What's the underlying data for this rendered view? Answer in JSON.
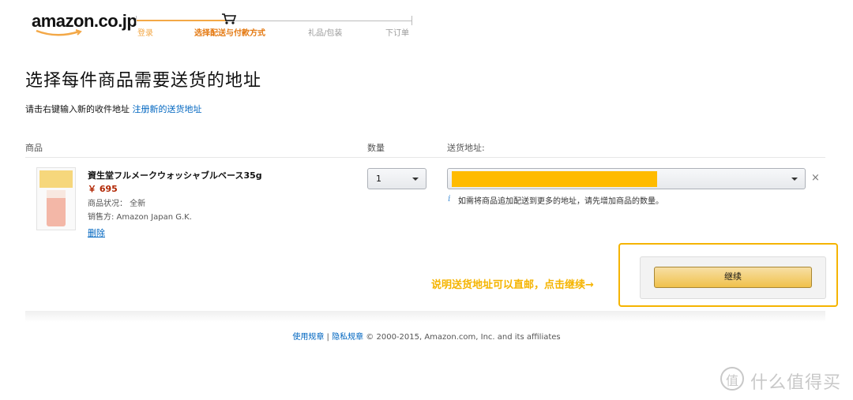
{
  "brand": {
    "logo_text": "amazon.co.jp",
    "accent": "#f3a847"
  },
  "progress": {
    "steps": [
      {
        "label": "登录",
        "state": "done"
      },
      {
        "label": "选择配送与付款方式",
        "state": "current"
      },
      {
        "label": "礼品/包装",
        "state": "pending"
      },
      {
        "label": "下订单",
        "state": "pending"
      }
    ],
    "icon": "shopping-cart-icon"
  },
  "page": {
    "title": "选择每件商品需要送货的地址",
    "instruction": "请击右键输入新的收件地址",
    "instruction_link": "注册新的送货地址"
  },
  "table": {
    "headers": {
      "product": "商品",
      "quantity": "数量",
      "address": "送货地址:"
    }
  },
  "item": {
    "name": "資生堂フルメークウォッシャブルベース35g",
    "price": "￥ 695",
    "condition": "商品状况： 全新",
    "seller": "销售方: Amazon Japan G.K.",
    "delete_label": "删除",
    "quantity": "1",
    "address_redacted_color": "#ffbb00",
    "address_note_icon": "i",
    "address_note": "如需将商品追加配送到更多的地址，请先增加商品的数量。",
    "remove_icon": "×"
  },
  "annotation": {
    "text": "说明送货地址可以直邮，点击继续→",
    "color": "#f5b400"
  },
  "actions": {
    "continue_label": "继续"
  },
  "footer": {
    "terms": "使用规章",
    "separator": "|",
    "privacy": "隐私规章",
    "copyright": "© 2000-2015, Amazon.com, Inc. and its affiliates"
  },
  "watermark": {
    "text": "什么值得买",
    "logo_char": "值"
  }
}
